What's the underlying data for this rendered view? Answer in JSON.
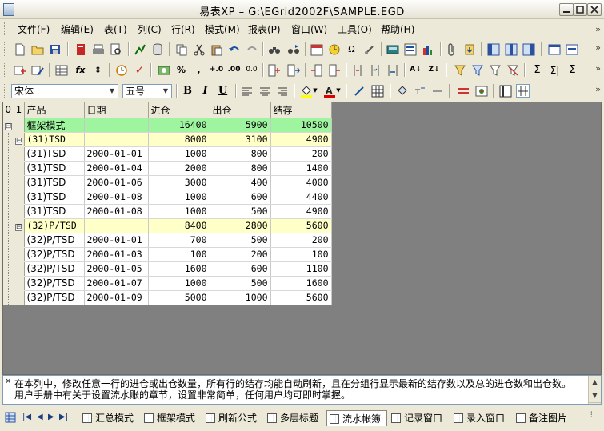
{
  "window": {
    "title": "易表XP  –  G:\\EGrid2002F\\SAMPLE.EGD"
  },
  "menu": [
    {
      "label": "文件(F)"
    },
    {
      "label": "编辑(E)"
    },
    {
      "label": "表(T)"
    },
    {
      "label": "列(C)"
    },
    {
      "label": "行(R)"
    },
    {
      "label": "模式(M)"
    },
    {
      "label": "报表(P)"
    },
    {
      "label": "窗口(W)"
    },
    {
      "label": "工具(O)"
    },
    {
      "label": "帮助(H)"
    }
  ],
  "format_toolbar": {
    "font_name": "宋体",
    "font_size": "五号",
    "bold": "B",
    "italic": "I",
    "underline": "U"
  },
  "grid": {
    "level_headers": [
      "0",
      "1"
    ],
    "columns": [
      "产品",
      "日期",
      "进仓",
      "出仓",
      "结存"
    ],
    "rows": [
      {
        "type": "total",
        "tree": "⊟",
        "product": "框架模式",
        "date": "",
        "in": "16400",
        "out": "5900",
        "balance": "10500"
      },
      {
        "type": "group",
        "tree": "⊟",
        "product": "(31)TSD",
        "date": "",
        "in": "8000",
        "out": "3100",
        "balance": "4900"
      },
      {
        "type": "detail",
        "product": "(31)TSD",
        "date": "2000-01-01",
        "in": "1000",
        "out": "800",
        "balance": "200"
      },
      {
        "type": "detail",
        "product": "(31)TSD",
        "date": "2000-01-04",
        "in": "2000",
        "out": "800",
        "balance": "1400"
      },
      {
        "type": "detail",
        "product": "(31)TSD",
        "date": "2000-01-06",
        "in": "3000",
        "out": "400",
        "balance": "4000"
      },
      {
        "type": "detail",
        "product": "(31)TSD",
        "date": "2000-01-08",
        "in": "1000",
        "out": "600",
        "balance": "4400"
      },
      {
        "type": "detail",
        "product": "(31)TSD",
        "date": "2000-01-08",
        "in": "1000",
        "out": "500",
        "balance": "4900"
      },
      {
        "type": "group",
        "tree": "⊟",
        "product": "(32)P/TSD",
        "date": "",
        "in": "8400",
        "out": "2800",
        "balance": "5600"
      },
      {
        "type": "detail",
        "product": "(32)P/TSD",
        "date": "2000-01-01",
        "in": "700",
        "out": "500",
        "balance": "200"
      },
      {
        "type": "detail",
        "product": "(32)P/TSD",
        "date": "2000-01-03",
        "in": "100",
        "out": "200",
        "balance": "100"
      },
      {
        "type": "detail",
        "product": "(32)P/TSD",
        "date": "2000-01-05",
        "in": "1600",
        "out": "600",
        "balance": "1100"
      },
      {
        "type": "detail",
        "product": "(32)P/TSD",
        "date": "2000-01-07",
        "in": "1000",
        "out": "500",
        "balance": "1600"
      },
      {
        "type": "detail",
        "product": "(32)P/TSD",
        "date": "2000-01-09",
        "in": "5000",
        "out": "1000",
        "balance": "5600"
      }
    ]
  },
  "notes": {
    "line1": "在本列中，修改任意一行的进仓或出仓数量，所有行的结存均能自动刷新，且在分组行显示最新的结存数以及总的进仓数和出仓数。",
    "line2": "用户手册中有关于设置流水账的章节，设置非常简单，任何用户均可即时掌握。"
  },
  "sheet_tabs": [
    {
      "label": "汇总模式"
    },
    {
      "label": "框架模式"
    },
    {
      "label": "刷新公式"
    },
    {
      "label": "多层标题"
    },
    {
      "label": "流水帐簿"
    },
    {
      "label": "记录窗口"
    },
    {
      "label": "录入窗口"
    },
    {
      "label": "备注图片"
    }
  ],
  "active_tab": "流水帐簿"
}
